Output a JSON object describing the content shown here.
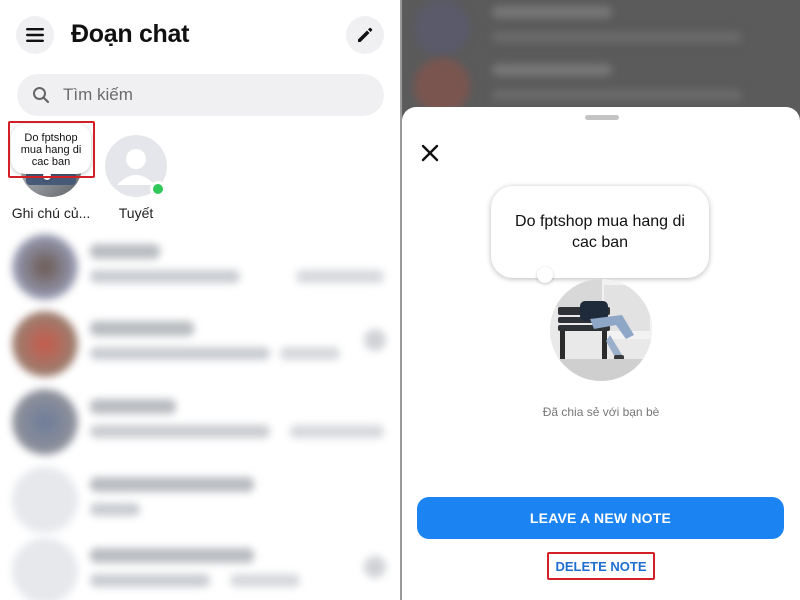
{
  "left_panel": {
    "header": {
      "title": "Đoạn chat",
      "menu_icon": "hamburger-menu-icon",
      "edit_icon": "pencil-compose-icon"
    },
    "search": {
      "placeholder": "Tìm kiếm",
      "icon": "search-icon"
    },
    "stories": [
      {
        "name": "Ghi chú củ...",
        "note": "Do fptshop mua hang di cac ban"
      },
      {
        "name": "Tuyết",
        "online": true
      }
    ]
  },
  "right_panel": {
    "note_sheet": {
      "close_icon": "close-icon",
      "note_text": "Do fptshop mua hang di cac ban",
      "shared_label": "Đã chia sẻ với bạn bè",
      "leave_note_label": "LEAVE A NEW NOTE",
      "delete_note_label": "DELETE NOTE"
    }
  },
  "colors": {
    "primary_button": "#1b83f2",
    "highlight_box": "#d31f26",
    "online_dot": "#31c85a",
    "delete_text": "#1f6fd1"
  }
}
